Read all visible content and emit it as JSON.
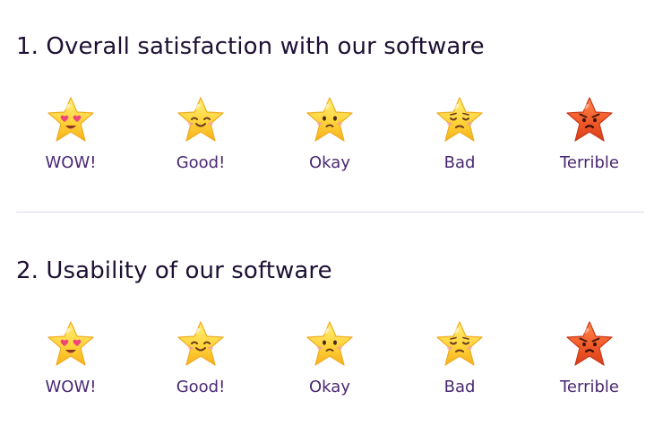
{
  "questions": [
    {
      "number": "1.",
      "title": "Overall satisfaction with our software",
      "options": [
        {
          "label": "WOW!",
          "icon": "heart-eyes-star-icon"
        },
        {
          "label": "Good!",
          "icon": "smiling-star-icon"
        },
        {
          "label": "Okay",
          "icon": "frowning-star-icon"
        },
        {
          "label": "Bad",
          "icon": "sad-star-icon"
        },
        {
          "label": "Terrible",
          "icon": "angry-red-star-icon"
        }
      ]
    },
    {
      "number": "2.",
      "title": "Usability of our software",
      "options": [
        {
          "label": "WOW!",
          "icon": "heart-eyes-star-icon"
        },
        {
          "label": "Good!",
          "icon": "smiling-star-icon"
        },
        {
          "label": "Okay",
          "icon": "frowning-star-icon"
        },
        {
          "label": "Bad",
          "icon": "sad-star-icon"
        },
        {
          "label": "Terrible",
          "icon": "angry-red-star-icon"
        }
      ]
    }
  ],
  "colors": {
    "title": "#1e1033",
    "label": "#4a2872",
    "star_yellow": "#ffd43b",
    "star_red": "#f25a2a",
    "divider": "#dedbe8"
  }
}
